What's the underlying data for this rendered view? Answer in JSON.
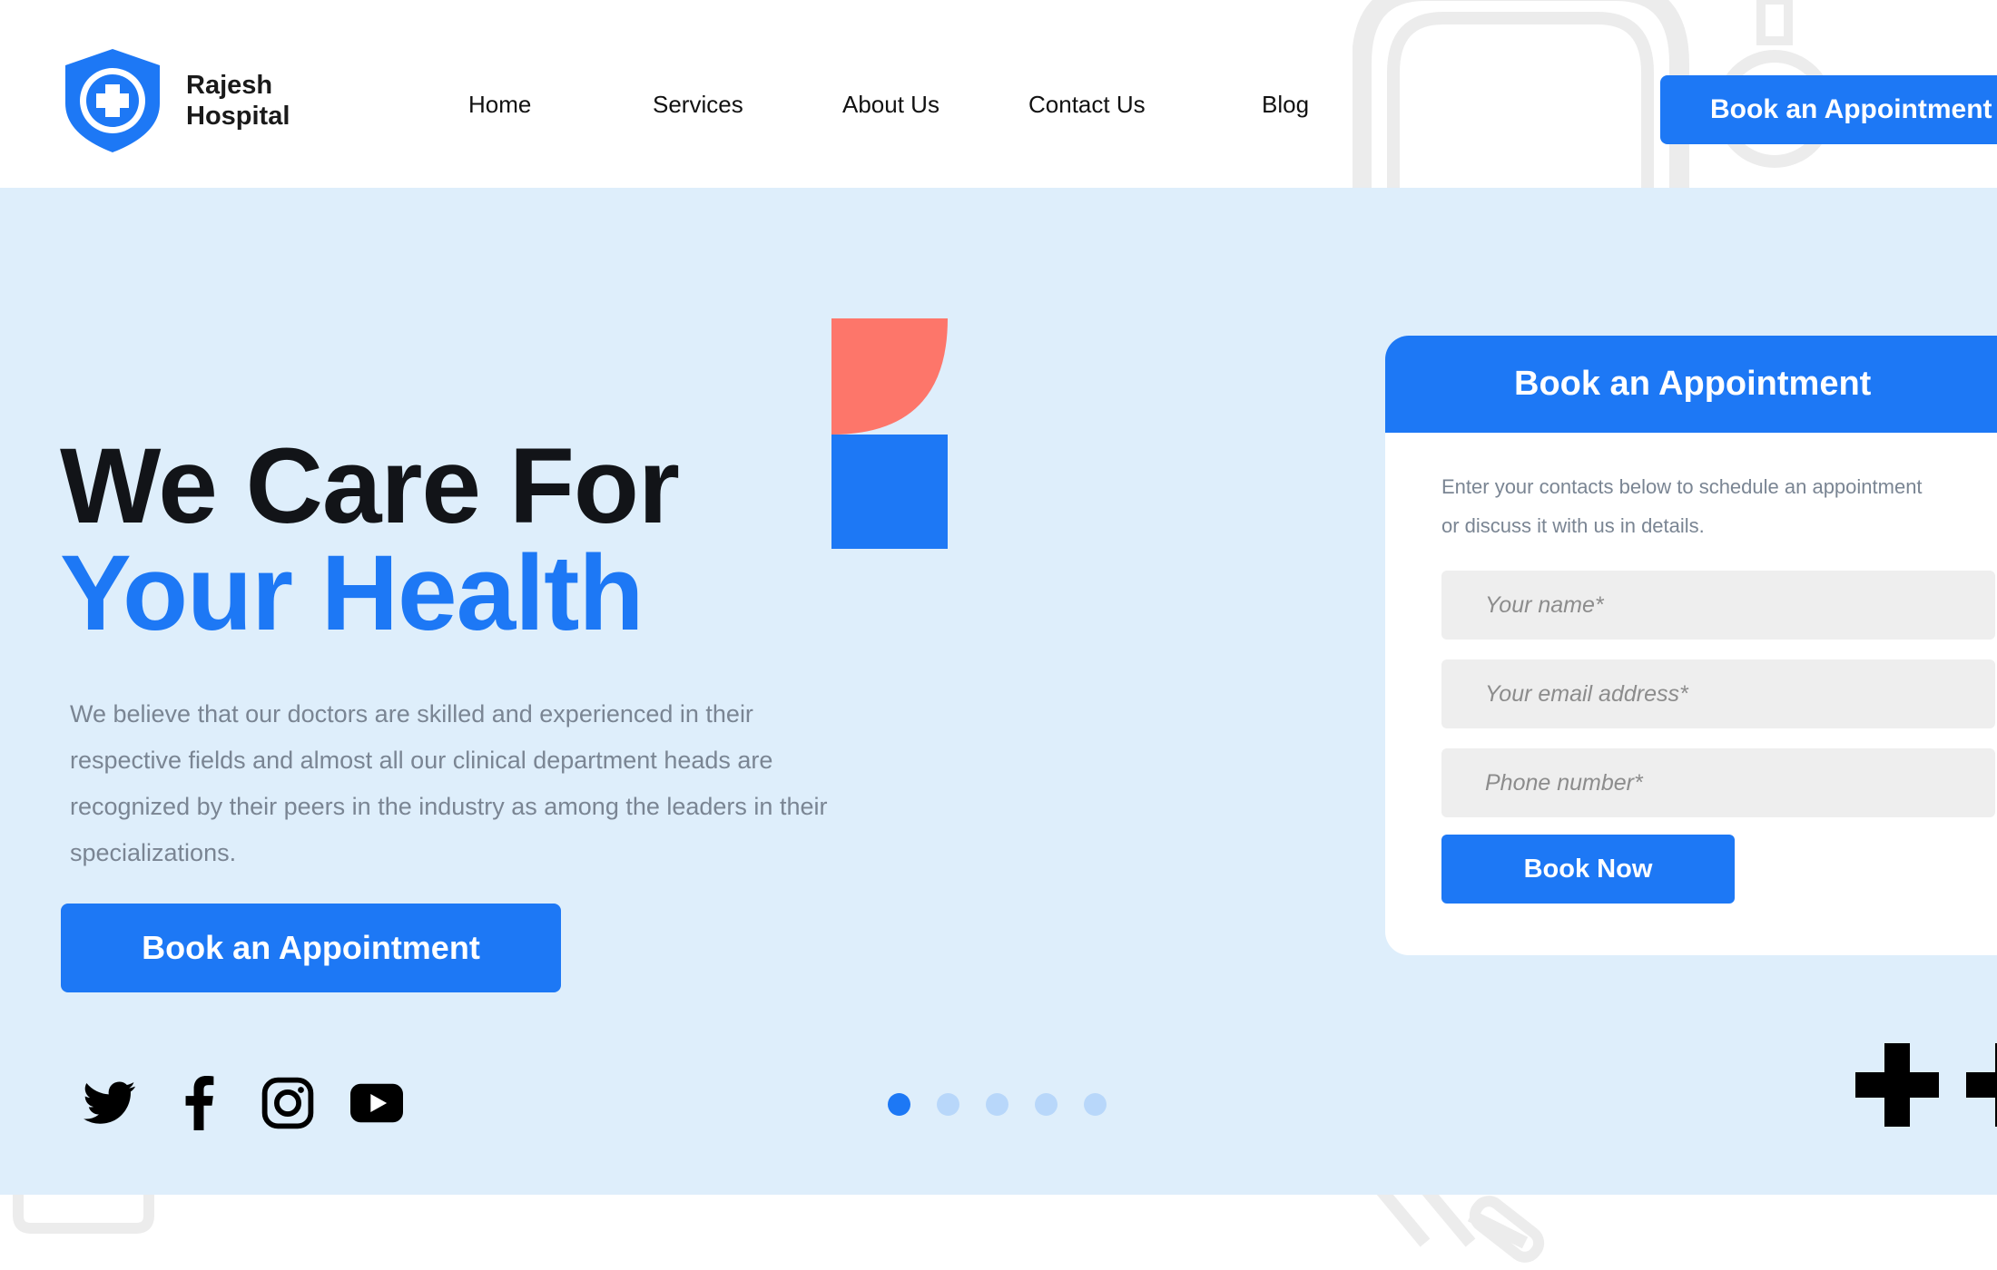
{
  "brand": {
    "name_line1": "Rajesh",
    "name_line2": "Hospital",
    "icon": "shield-cross-icon",
    "accent_color": "#1d78f5"
  },
  "nav": {
    "items": [
      {
        "label": "Home"
      },
      {
        "label": "Services"
      },
      {
        "label": "About Us"
      },
      {
        "label": "Contact Us"
      },
      {
        "label": "Blog"
      }
    ],
    "cta_label": "Book an Appointment"
  },
  "hero": {
    "headline_line1": "We Care For",
    "headline_line2": "Your Health",
    "description": "We believe that our doctors are skilled and experienced in their respective fields and almost all our clinical department heads are recognized by their peers in the industry as among the leaders in their specializations.",
    "cta_label": "Book an Appointment",
    "background_color": "#deeefb",
    "shape_colors": {
      "coral": "#fd766a",
      "blue": "#1d78f5"
    }
  },
  "social": [
    {
      "icon": "twitter-icon"
    },
    {
      "icon": "facebook-icon"
    },
    {
      "icon": "instagram-icon"
    },
    {
      "icon": "youtube-icon"
    }
  ],
  "carousel": {
    "total_slides": 5,
    "active_slide": 1
  },
  "appointment_form": {
    "title": "Book an Appointment",
    "subtitle_line1": "Enter your contacts below to schedule an appointment",
    "subtitle_line2": "or discuss it with us in details.",
    "name_placeholder": "Your name*",
    "email_placeholder": "Your email address*",
    "phone_placeholder": "Phone number*",
    "submit_label": "Book Now"
  }
}
